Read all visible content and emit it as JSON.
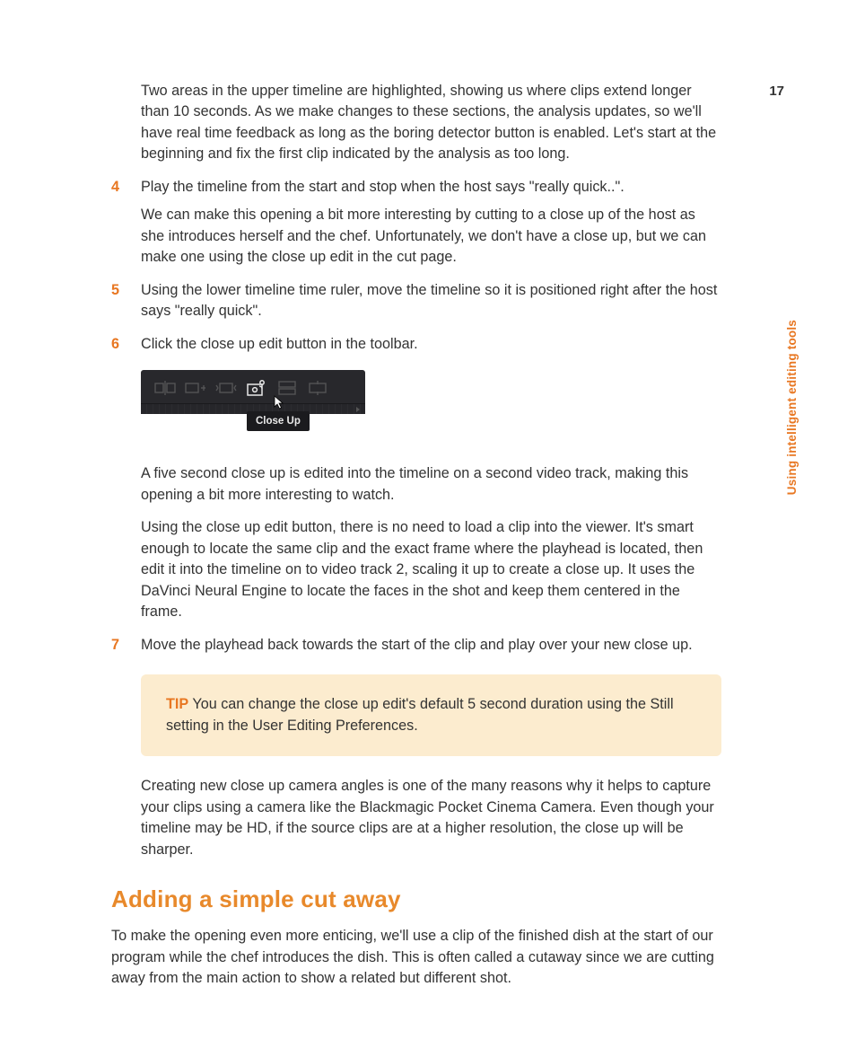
{
  "pageNumber": "17",
  "sideLabel": "Using intelligent editing tools",
  "intro": "Two areas in the upper timeline are highlighted, showing us where clips extend longer than 10 seconds. As we make changes to these sections, the analysis updates, so we'll have real time feedback as long as the boring detector button is enabled. Let's start at the beginning and fix the first clip indicated by the analysis as too long.",
  "steps": {
    "s4": {
      "num": "4",
      "p1": "Play the timeline from the start and stop when the host says \"really quick..\".",
      "p2": "We can make this opening a bit more interesting by cutting to a close up of the host as she introduces herself and the chef. Unfortunately, we don't have a close up, but we can make one using the close up edit in the cut page."
    },
    "s5": {
      "num": "5",
      "p1": "Using the lower timeline time ruler, move the timeline so it is positioned right after the host says \"really quick\"."
    },
    "s6": {
      "num": "6",
      "p1": "Click the close up edit button in the toolbar."
    },
    "s7": {
      "num": "7",
      "p1": "Move the playhead back towards the start of the clip and play over your new close up."
    }
  },
  "toolbarTooltip": "Close Up",
  "afterFig1": "A five second close up is edited into the timeline on a second video track, making this opening a bit more interesting to watch.",
  "afterFig2": "Using the close up edit button, there is no need to load a clip into the viewer. It's smart enough to locate the same clip and the exact frame where the playhead is located, then edit it into the timeline on to video track 2, scaling it up to create a close up. It uses the DaVinci Neural Engine to locate the faces in the shot and keep them centered in the frame.",
  "tip": {
    "label": "TIP",
    "text": "  You can change the close up edit's default 5 second duration using the Still setting in the User Editing Preferences."
  },
  "afterTip": "Creating new close up camera angles is one of the many reasons why it helps to capture your clips using a camera like the Blackmagic Pocket Cinema Camera. Even though your timeline may be HD, if the source clips are at a higher resolution, the close up will be sharper.",
  "sectionHeading": "Adding a simple cut away",
  "sectionPara": "To make the opening even more enticing, we'll use a clip of the finished dish at the start of our program while the chef introduces the dish. This is often called a cutaway since we are cutting away from the main action to show a related but different shot."
}
